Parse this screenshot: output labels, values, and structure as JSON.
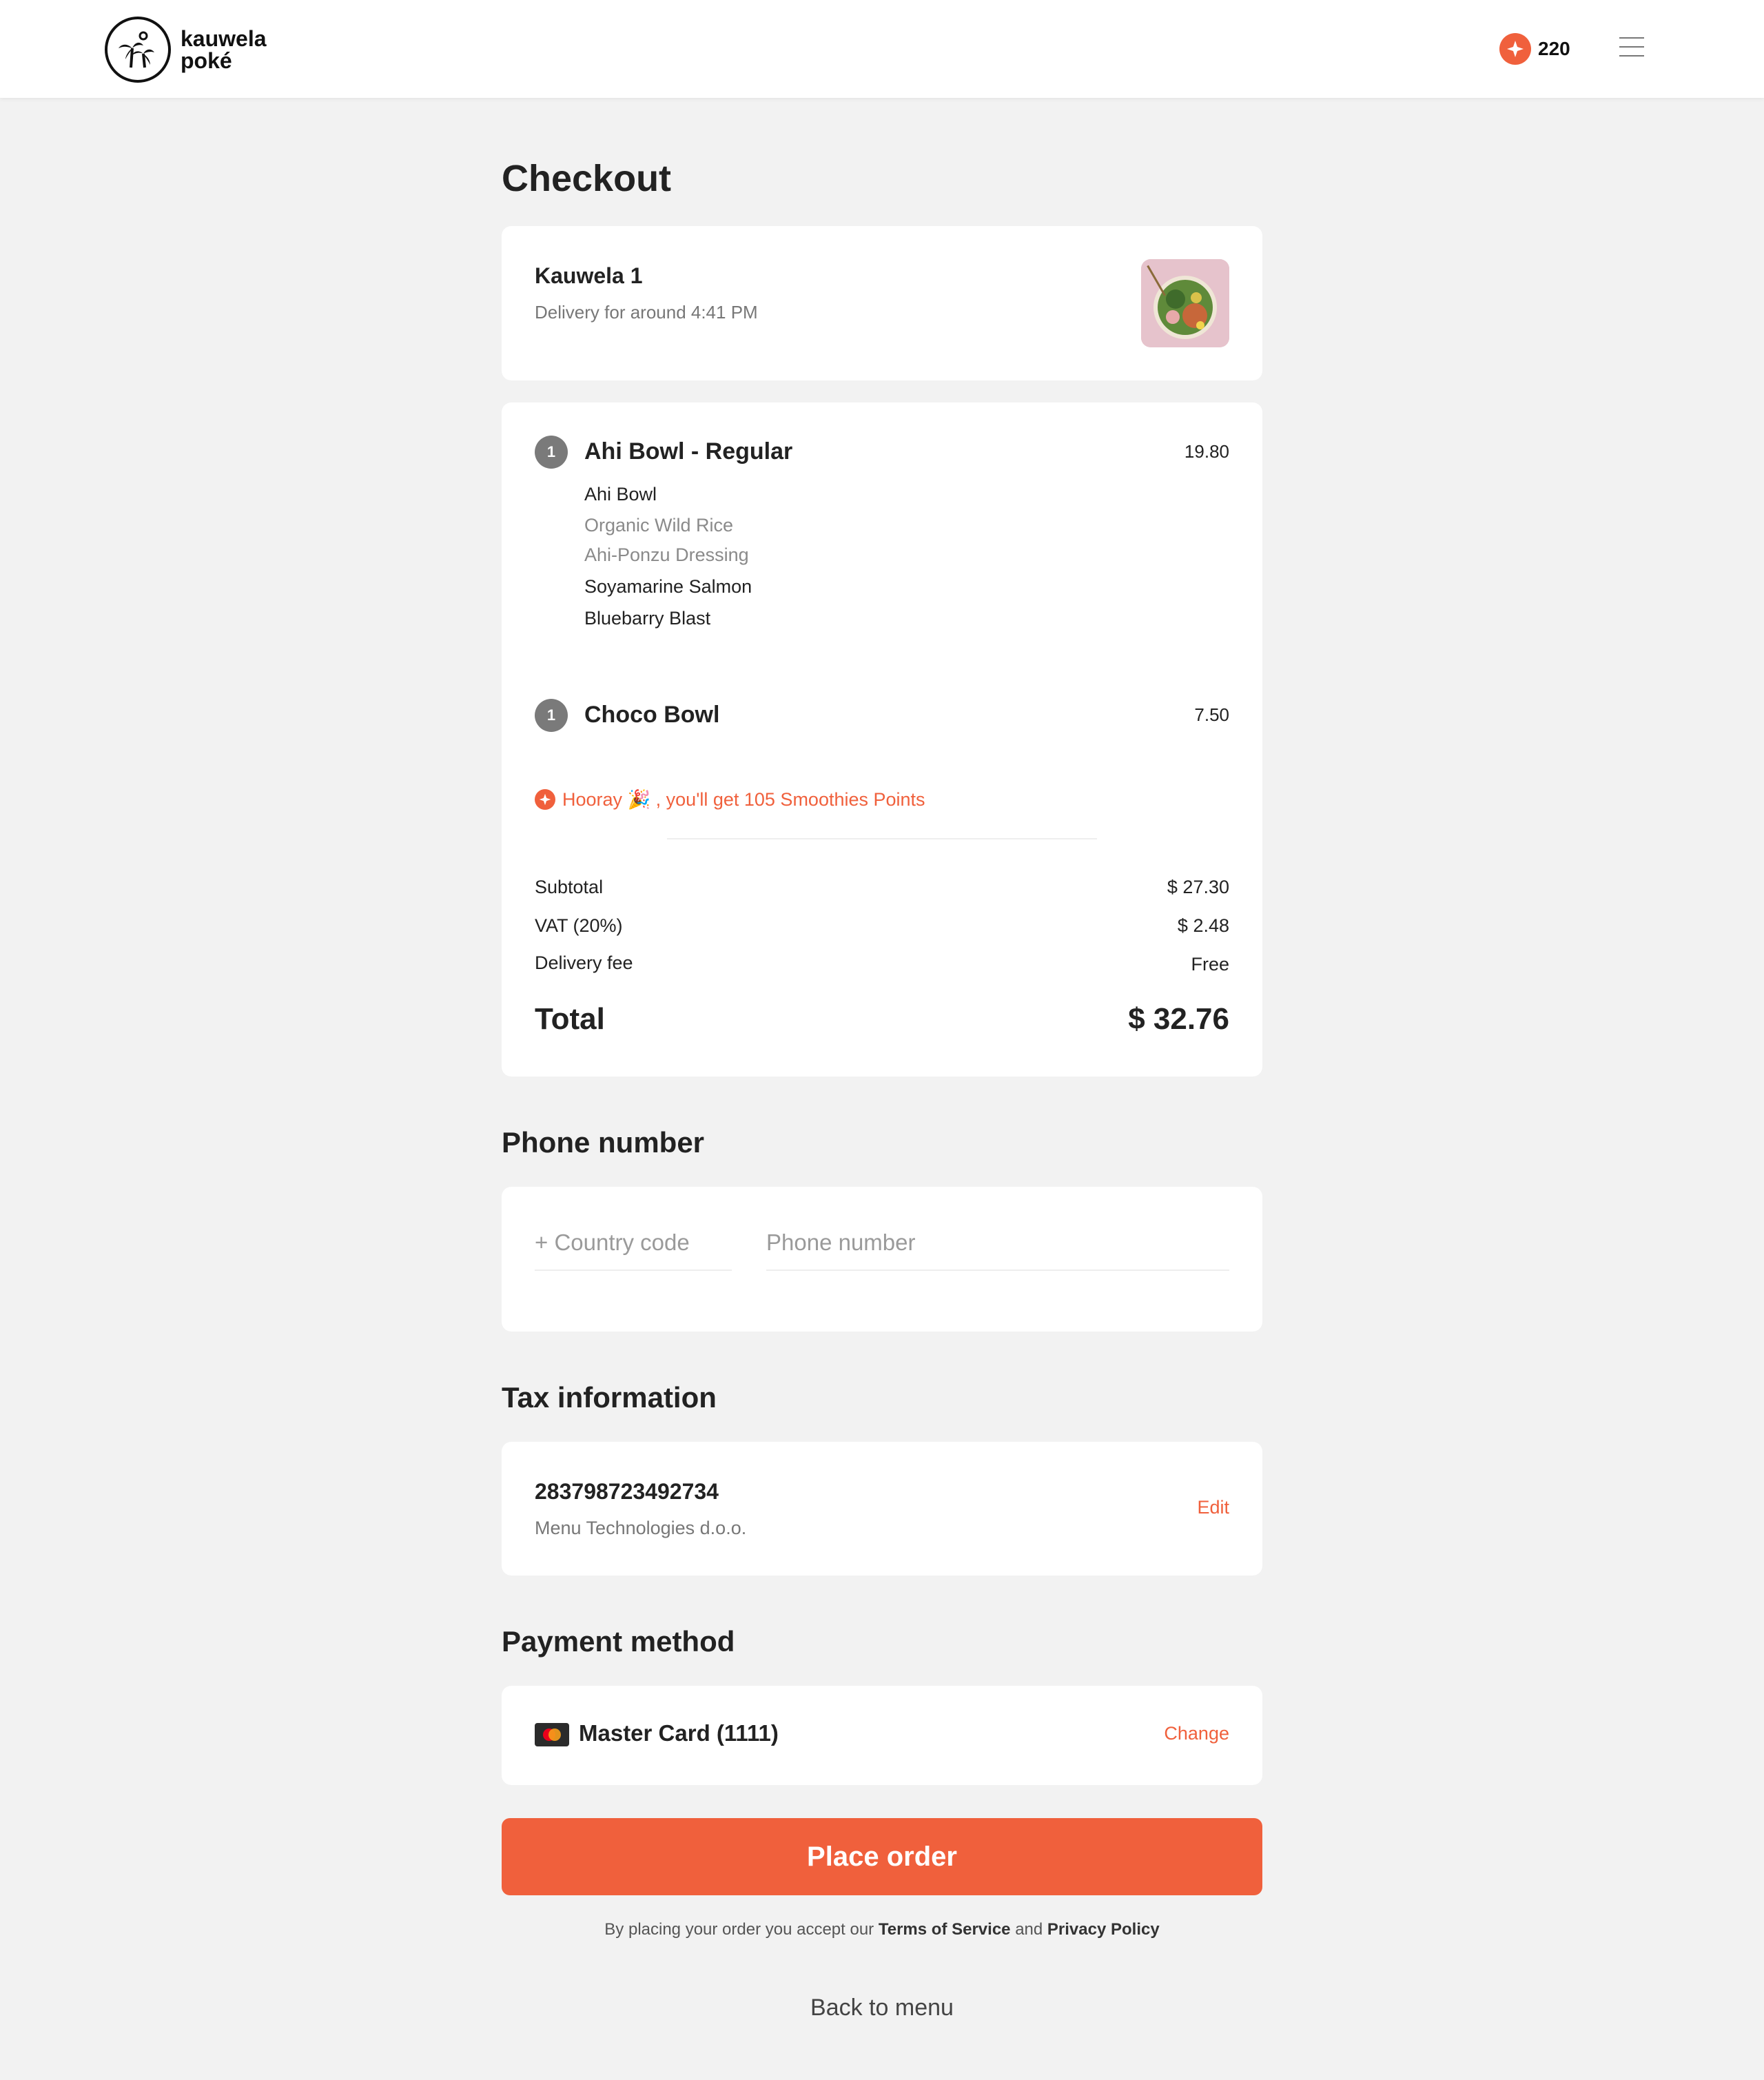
{
  "header": {
    "logo_line1": "kauwela",
    "logo_line2": "poké",
    "points": "220",
    "accent_color": "#f0603c"
  },
  "page": {
    "title": "Checkout"
  },
  "restaurant": {
    "name": "Kauwela 1",
    "eta": "Delivery for around 4:41 PM",
    "image_icon": "poke-bowl-photo"
  },
  "order": {
    "items": [
      {
        "qty": "1",
        "name": "Ahi Bowl - Regular",
        "price": "19.80",
        "modifiers": [
          "Ahi Bowl",
          "Organic Wild Rice",
          "Ahi-Ponzu Dressing",
          "Soyamarine Salmon",
          "Bluebarry Blast"
        ]
      },
      {
        "qty": "1",
        "name": "Choco Bowl",
        "price": "7.50",
        "modifiers": []
      }
    ],
    "reward_text": "Hooray 🎉 , you'll get 105 Smoothies Points",
    "subtotal_label": "Subtotal",
    "subtotal": "$ 27.30",
    "vat_label": "VAT (20%)",
    "vat": "$ 2.48",
    "delivery_label": "Delivery fee",
    "delivery": "Free",
    "total_label": "Total",
    "total": "$ 32.76"
  },
  "phone": {
    "title": "Phone number",
    "country_placeholder": "+ Country code",
    "number_placeholder": "Phone number"
  },
  "tax": {
    "title": "Tax information",
    "id": "283798723492734",
    "company": "Menu Technologies d.o.o.",
    "edit_label": "Edit"
  },
  "payment": {
    "title": "Payment method",
    "card": "Master Card (1111)",
    "change_label": "Change"
  },
  "actions": {
    "place_order": "Place order",
    "terms_prefix": "By placing your order you accept our",
    "terms_link": "Terms of Service",
    "terms_and": "and",
    "privacy_link": "Privacy Policy",
    "back": "Back to menu"
  }
}
